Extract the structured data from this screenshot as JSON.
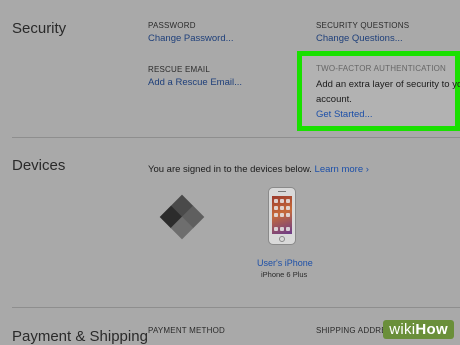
{
  "security": {
    "title": "Security",
    "password_label": "PASSWORD",
    "password_link": "Change Password...",
    "questions_label": "SECURITY QUESTIONS",
    "questions_link": "Change Questions...",
    "rescue_label": "RESCUE EMAIL",
    "rescue_link": "Add a Rescue Email...",
    "tfa": {
      "label": "TWO-FACTOR AUTHENTICATION",
      "text_line1": "Add an extra layer of security to yo",
      "text_line2": "account.",
      "link": "Get Started..."
    }
  },
  "devices": {
    "title": "Devices",
    "signed_in_text": "You are signed in to the devices below.",
    "learn_more": "Learn more",
    "items": [
      {
        "name": "User's iPhone",
        "model": "iPhone 6 Plus"
      }
    ]
  },
  "payment": {
    "title": "Payment & Shipping",
    "payment_label": "PAYMENT METHOD",
    "shipping_label": "SHIPPING ADDRESS"
  },
  "watermark": {
    "prefix": "wiki",
    "suffix": "How"
  },
  "colors": {
    "highlight": "#19e000",
    "link": "#1e3f7a",
    "background": "#a9a9a9"
  },
  "icons": {
    "learn_more_chevron": "chevron-right-icon",
    "icloud_logo": "diamond-logo-icon"
  }
}
